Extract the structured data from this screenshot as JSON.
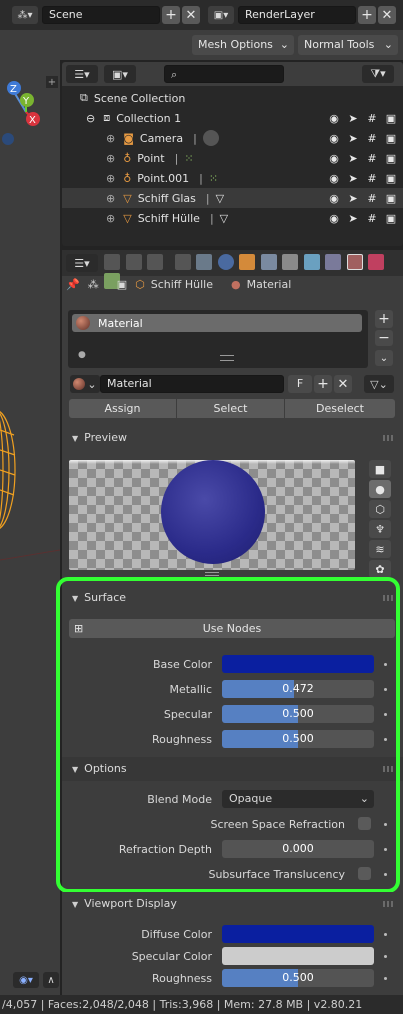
{
  "topbar": {
    "scene_label": "Scene",
    "layer_label": "RenderLayer",
    "mesh_options": "Mesh Options",
    "normal_tools": "Normal Tools"
  },
  "outliner": {
    "items": [
      {
        "label": "Scene Collection"
      },
      {
        "label": "Collection 1"
      },
      {
        "label": "Camera"
      },
      {
        "label": "Point"
      },
      {
        "label": "Point.001"
      },
      {
        "label": "Schiff Glas"
      },
      {
        "label": "Schiff Hülle"
      }
    ]
  },
  "properties": {
    "breadcrumb_object": "Schiff Hülle",
    "breadcrumb_material": "Material",
    "slot_name": "Material",
    "material_field": "Material",
    "fake_user": "F",
    "assign": "Assign",
    "select": "Select",
    "deselect": "Deselect"
  },
  "panels": {
    "preview": "Preview",
    "surface": "Surface",
    "options": "Options",
    "viewport": "Viewport Display"
  },
  "surface": {
    "use_nodes": "Use Nodes",
    "base_color_label": "Base Color",
    "base_color": "#0a1fa0",
    "metallic_label": "Metallic",
    "metallic_value": "0.472",
    "metallic_fraction": 0.472,
    "specular_label": "Specular",
    "specular_value": "0.500",
    "specular_fraction": 0.5,
    "roughness_label": "Roughness",
    "roughness_value": "0.500",
    "roughness_fraction": 0.5
  },
  "options": {
    "blend_mode_label": "Blend Mode",
    "blend_mode_value": "Opaque",
    "ssr_label": "Screen Space Refraction",
    "refraction_depth_label": "Refraction Depth",
    "refraction_depth_value": "0.000",
    "subsurface_label": "Subsurface Translucency"
  },
  "viewport_display": {
    "diffuse_label": "Diffuse Color",
    "diffuse_color": "#0a1fa0",
    "specular_color_label": "Specular Color",
    "specular_color": "#cccccc",
    "roughness_label": "Roughness",
    "roughness_value": "0.500",
    "roughness_fraction": 0.5
  },
  "statusbar": {
    "text": "/4,057 | Faces:2,048/2,048 | Tris:3,968 | Mem: 27.8 MB | v2.80.21"
  },
  "highlight_color": "#33ff33"
}
